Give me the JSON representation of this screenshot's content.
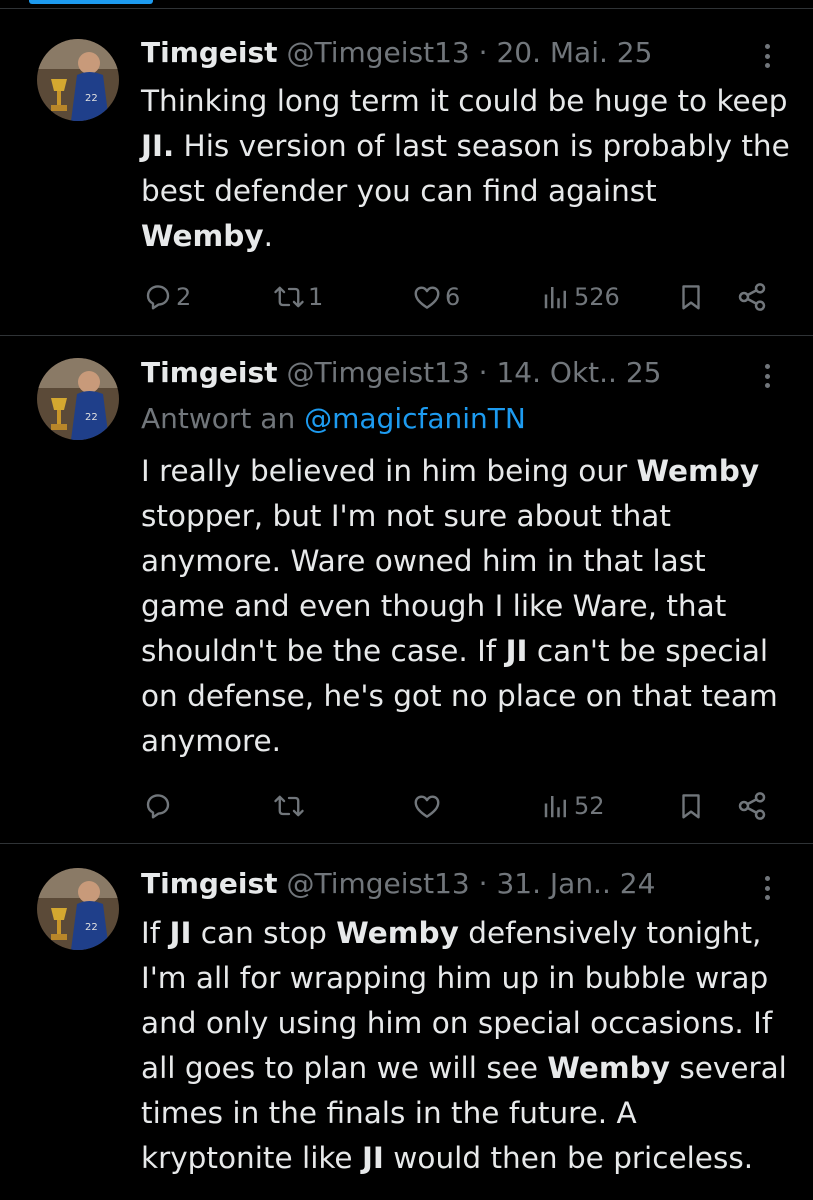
{
  "tweets": [
    {
      "name": "Timgeist",
      "handle": "@Timgeist13",
      "separator": "·",
      "date": "20. Mai. 25",
      "reply_prefix": "",
      "reply_mention": "",
      "segments": [
        {
          "text": "Thinking long term it could be huge to keep ",
          "bold": false
        },
        {
          "text": "JI.",
          "bold": true
        },
        {
          "text": " His version of last season is probably the best defender you can find against ",
          "bold": false
        },
        {
          "text": "Wemby",
          "bold": true
        },
        {
          "text": ".",
          "bold": false
        }
      ],
      "counts": {
        "replies": "2",
        "reposts": "1",
        "likes": "6",
        "views": "526"
      }
    },
    {
      "name": "Timgeist",
      "handle": "@Timgeist13",
      "separator": "·",
      "date": "14. Okt.. 25",
      "reply_prefix": "Antwort an",
      "reply_mention": "@magicfaninTN",
      "segments": [
        {
          "text": "I really believed in him being our ",
          "bold": false
        },
        {
          "text": "Wemby",
          "bold": true
        },
        {
          "text": " stopper, but I'm not sure about that anymore. Ware owned him in that last game and even though I like Ware, that shouldn't be the case. If ",
          "bold": false
        },
        {
          "text": "JI",
          "bold": true
        },
        {
          "text": " can't be special on defense, he's got no place on that team anymore.",
          "bold": false
        }
      ],
      "counts": {
        "replies": "",
        "reposts": "",
        "likes": "",
        "views": "52"
      }
    },
    {
      "name": "Timgeist",
      "handle": "@Timgeist13",
      "separator": "·",
      "date": "31. Jan.. 24",
      "reply_prefix": "",
      "reply_mention": "",
      "segments": [
        {
          "text": "If ",
          "bold": false
        },
        {
          "text": "JI",
          "bold": true
        },
        {
          "text": " can stop ",
          "bold": false
        },
        {
          "text": "Wemby",
          "bold": true
        },
        {
          "text": " defensively tonight, I'm all for wrapping him up in bubble wrap and only using him on special occasions. If all goes to plan we will see ",
          "bold": false
        },
        {
          "text": "Wemby",
          "bold": true
        },
        {
          "text": " several times in the finals in the future. A kryptonite like ",
          "bold": false
        },
        {
          "text": "JI",
          "bold": true
        },
        {
          "text": " would then be priceless.",
          "bold": false
        }
      ],
      "counts": {
        "replies": "",
        "reposts": "",
        "likes": "",
        "views": ""
      }
    }
  ],
  "icons": {
    "more": "more-vertical-icon",
    "reply": "reply-bubble-icon",
    "repost": "repost-icon",
    "like": "heart-icon",
    "views": "views-bars-icon",
    "bookmark": "bookmark-icon",
    "share": "share-icon"
  },
  "colors": {
    "background": "#000000",
    "text": "#e7e9ea",
    "muted": "#71767b",
    "accent": "#1d9bf0",
    "divider": "#2f3336"
  }
}
